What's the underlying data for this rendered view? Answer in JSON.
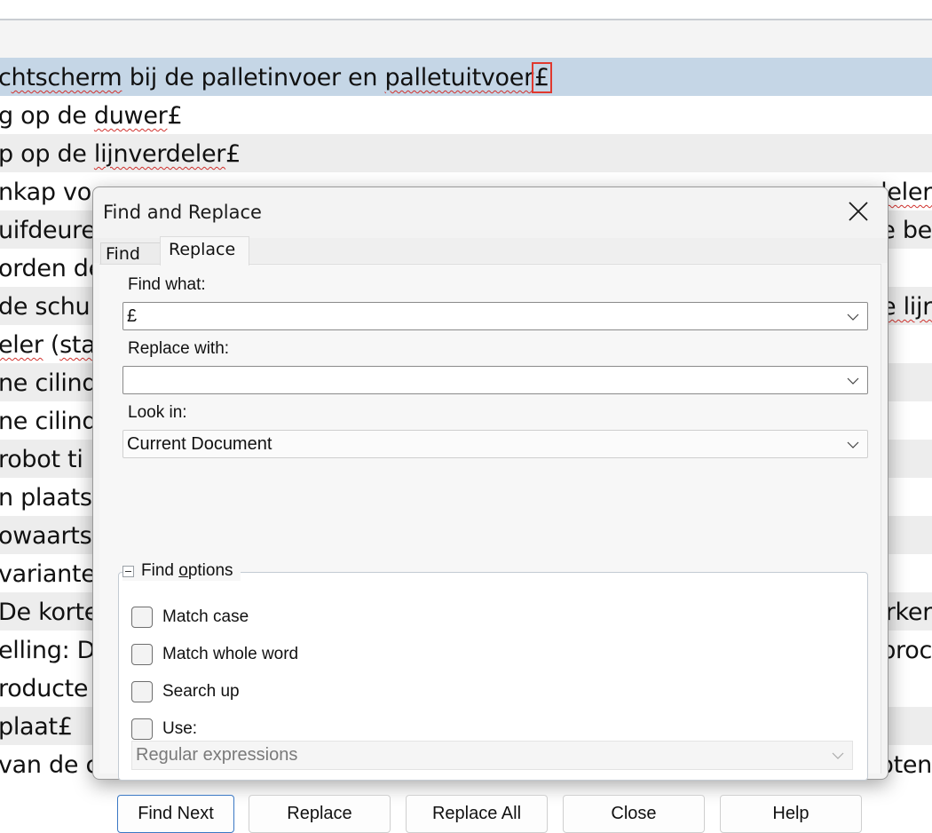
{
  "document": {
    "rows": [
      {
        "left": "chtscherm bij de palletinvoer en palletuitvoer",
        "hit": "£",
        "style": "sel"
      },
      {
        "left": "g op de duwer£",
        "style": "plain"
      },
      {
        "left": "p op de lijnverdeler£",
        "style": "alt"
      },
      {
        "left": "nkap vo",
        "right": "deler",
        "style": "plain"
      },
      {
        "left": "uifdeure",
        "right": "e be",
        "style": "alt"
      },
      {
        "left": "orden de",
        "right": "",
        "style": "plain"
      },
      {
        "left": "de schu",
        "right": "e lijr",
        "style": "alt"
      },
      {
        "left": "eler (star",
        "right": "",
        "style": "plain"
      },
      {
        "left": "ne cilind",
        "right": "",
        "style": "alt"
      },
      {
        "left": "ne cilind",
        "right": "",
        "style": "plain"
      },
      {
        "left": "robot ti",
        "right": "",
        "style": "alt"
      },
      {
        "left": "n plaats",
        "right": "",
        "style": "plain"
      },
      {
        "left": "owaarts",
        "right": "",
        "style": "alt"
      },
      {
        "left": "variante",
        "right": "",
        "style": "plain"
      },
      {
        "left": "De korte",
        "right": "rker",
        "style": "alt"
      },
      {
        "left": "elling: D",
        "right": "proc",
        "style": "plain"
      },
      {
        "left": "roducte",
        "right": "",
        "style": "plain"
      },
      {
        "left": "plaat£",
        "right": "",
        "style": "alt"
      },
      {
        "left": "van de c",
        "right": "oten",
        "style": "plain"
      }
    ]
  },
  "dialog": {
    "title": "Find and Replace",
    "close_icon": "close-icon",
    "tabs": [
      {
        "label": "Find",
        "active": false
      },
      {
        "label": "Replace",
        "active": true
      }
    ],
    "find_what": {
      "label": "Find what:",
      "value": "£"
    },
    "replace_with": {
      "label": "Replace with:",
      "value": ""
    },
    "look_in": {
      "label": "Look in:",
      "value": "Current Document"
    },
    "find_options": {
      "legend_pre": "Find ",
      "legend_ul": "o",
      "legend_post": "ptions",
      "expanded": true,
      "checkboxes": [
        {
          "label": "Match case",
          "checked": false
        },
        {
          "label": "Match whole word",
          "checked": false
        },
        {
          "label": "Search up",
          "checked": false
        },
        {
          "label": "Use:",
          "checked": false
        }
      ],
      "use_mode": "Regular expressions"
    },
    "buttons": {
      "find_next": "Find Next",
      "replace": "Replace",
      "replace_all": "Replace All",
      "close": "Close",
      "help": "Help"
    }
  },
  "colors": {
    "selection_row": "#c5d6e6",
    "match_outline": "#e0392f",
    "default_button_border": "#3a78c4"
  }
}
